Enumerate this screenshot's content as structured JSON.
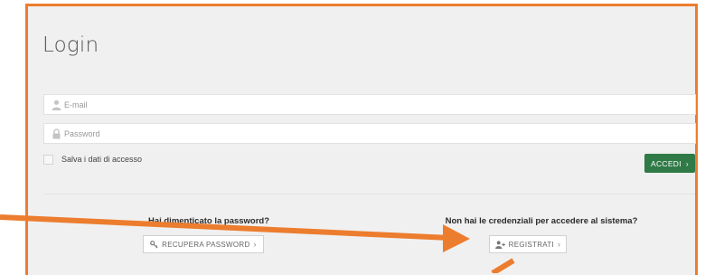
{
  "login": {
    "title": "Login",
    "email_placeholder": "E-mail",
    "password_placeholder": "Password",
    "remember_label": "Salva i dati di accesso",
    "submit_label": "ACCEDI",
    "submit_chevron": "›"
  },
  "forgot": {
    "heading": "Hai dimenticato la password?",
    "button_label": "RECUPERA PASSWORD",
    "button_chevron": "›",
    "button_icon": "key-icon"
  },
  "register": {
    "heading": "Non hai le credenziali per accedere al sistema?",
    "button_label": "REGISTRATI",
    "button_chevron": "›",
    "button_icon": "user-plus-icon"
  },
  "colors": {
    "panel_border": "#ec7d2e",
    "annotation_arrow": "#ec7d2e",
    "primary_button": "#2f7a46",
    "panel_background": "#f0f0f0"
  }
}
